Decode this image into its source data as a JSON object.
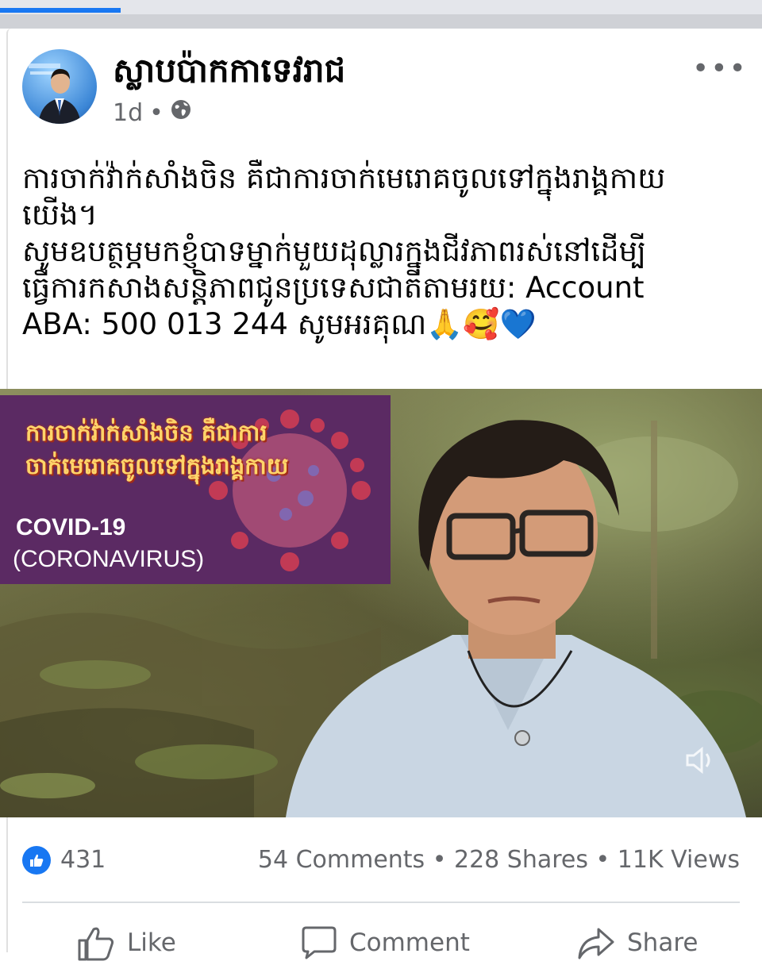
{
  "post": {
    "author": "ស្លាបប៉ាកកាទេវរាជ",
    "time": "1d",
    "separator": "•",
    "privacy_icon": "globe-icon",
    "more_icon": "more-options-icon",
    "text_lines": [
      "ការចាក់វ៉ាក់សាំងចិន គឺជាការចាក់មេរោគចូលទៅក្នុងរាង្គកាយ",
      "យើង។",
      "សូមឧបត្ថម្ភមកខ្ញុំបាទម្នាក់មួយដុល្លារក្នុងជីវភាពរស់នៅដើម្បី",
      "ធ្វើការកសាងសន្តិភាពជូនប្រទេសជាតិតាមរយ: Account",
      "ABA: 500 013 244 សូមអរគុណ🙏🥰💙"
    ]
  },
  "video": {
    "overlay_title_lines": [
      "ការចាក់វ៉ាក់សាំងចិន គឺជាការ",
      "ចាក់មេរោគចូលទៅក្នុងរាង្គកាយ"
    ],
    "covid_label": "COVID-19",
    "corona_label": "(CORONAVIRUS)",
    "volume_icon": "volume-muted-icon"
  },
  "stats": {
    "likes": "431",
    "comments": "54 Comments",
    "shares": "228 Shares",
    "views": "11K Views",
    "dot": "•"
  },
  "actions": {
    "like": "Like",
    "comment": "Comment",
    "share": "Share"
  },
  "colors": {
    "accent": "#1877f2",
    "text_secondary": "#65676b",
    "overlay_bg": "#5b2a63"
  }
}
